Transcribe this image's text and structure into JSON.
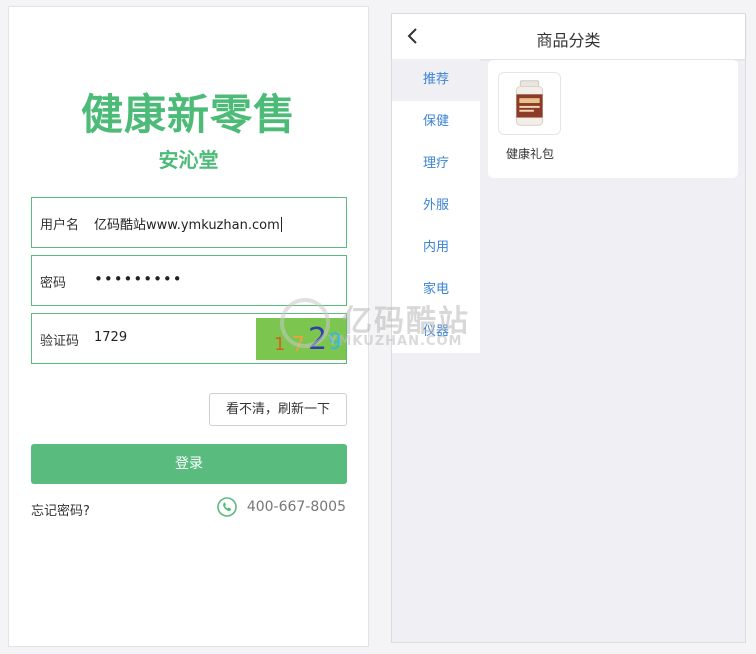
{
  "login": {
    "title": "健康新零售",
    "subtitle": "安沁堂",
    "username": {
      "label": "用户名",
      "value": "亿码酷站www.ymkuzhan.com"
    },
    "password": {
      "label": "密码",
      "value": "•••••••••"
    },
    "captcha": {
      "label": "验证码",
      "value": "1729",
      "image_chars": [
        "1",
        "7",
        "2",
        "9"
      ]
    },
    "refresh_label": "看不清，刷新一下",
    "login_label": "登录",
    "forgot_label": "忘记密码?",
    "phone": "400-667-8005",
    "colors": {
      "accent": "#59bb7d",
      "brand": "#4dbb78"
    }
  },
  "category": {
    "title": "商品分类",
    "nav": [
      {
        "label": "推荐",
        "active": true
      },
      {
        "label": "保健"
      },
      {
        "label": "理疗"
      },
      {
        "label": "外服"
      },
      {
        "label": "内用"
      },
      {
        "label": "家电"
      },
      {
        "label": "仪器"
      }
    ],
    "goods": [
      {
        "name": "健康礼包"
      }
    ],
    "link_color": "#3a83d5"
  },
  "watermark": {
    "text": "亿码酷站",
    "sub": "YMKUZHAN.COM"
  }
}
